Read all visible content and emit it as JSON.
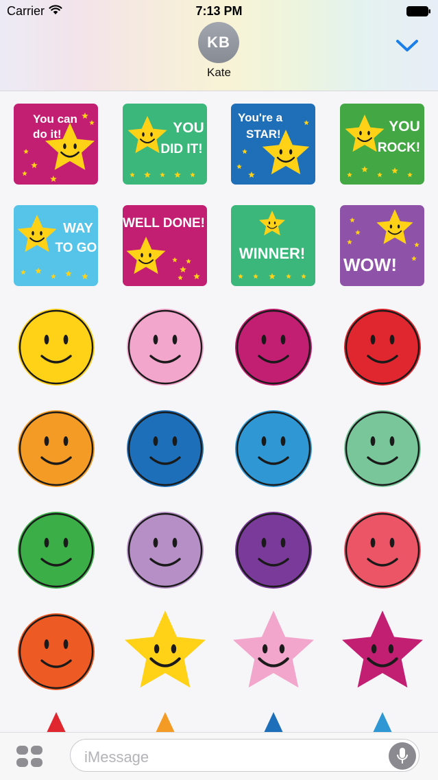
{
  "status_bar": {
    "carrier": "Carrier",
    "time": "7:13 PM"
  },
  "header": {
    "avatar_initials": "KB",
    "contact_name": "Kate"
  },
  "stickers": [
    {
      "type": "card",
      "name": "you-can-do-it",
      "bg": "#c31f72",
      "lines": [
        "You can",
        "do it!"
      ]
    },
    {
      "type": "card",
      "name": "you-did-it",
      "bg": "#3cb77c",
      "lines": [
        "YOU",
        "DID IT!"
      ]
    },
    {
      "type": "card",
      "name": "youre-a-star",
      "bg": "#1f6fb8",
      "lines": [
        "You're a",
        "STAR!"
      ]
    },
    {
      "type": "card",
      "name": "you-rock",
      "bg": "#43a844",
      "lines": [
        "YOU",
        "ROCK!"
      ]
    },
    {
      "type": "card",
      "name": "way-to-go",
      "bg": "#56c4e8",
      "lines": [
        "WAY",
        "TO GO!"
      ]
    },
    {
      "type": "card",
      "name": "well-done",
      "bg": "#c31f72",
      "lines": [
        "WELL DONE!"
      ]
    },
    {
      "type": "card",
      "name": "winner",
      "bg": "#3cb77c",
      "lines": [
        "WINNER!"
      ]
    },
    {
      "type": "card",
      "name": "wow",
      "bg": "#8e53a8",
      "lines": [
        "WOW!"
      ]
    },
    {
      "type": "smiley",
      "name": "yellow",
      "color": "#ffd218"
    },
    {
      "type": "smiley",
      "name": "pink",
      "color": "#f3a6cb"
    },
    {
      "type": "smiley",
      "name": "magenta",
      "color": "#c31f72"
    },
    {
      "type": "smiley",
      "name": "red",
      "color": "#e0262e"
    },
    {
      "type": "smiley",
      "name": "orange",
      "color": "#f49b25"
    },
    {
      "type": "smiley",
      "name": "blue",
      "color": "#1e6fb9"
    },
    {
      "type": "smiley",
      "name": "light-blue",
      "color": "#2f97d4"
    },
    {
      "type": "smiley",
      "name": "mint",
      "color": "#78c69a"
    },
    {
      "type": "smiley",
      "name": "green",
      "color": "#3cae48"
    },
    {
      "type": "smiley",
      "name": "lilac",
      "color": "#b58fc6"
    },
    {
      "type": "smiley",
      "name": "purple",
      "color": "#7a3a9a"
    },
    {
      "type": "smiley",
      "name": "coral",
      "color": "#ec5566"
    },
    {
      "type": "smiley",
      "name": "red-orange",
      "color": "#ee5a24"
    },
    {
      "type": "star",
      "name": "yellow",
      "color": "#ffd218"
    },
    {
      "type": "star",
      "name": "pink",
      "color": "#f3a6cb"
    },
    {
      "type": "star",
      "name": "magenta",
      "color": "#c31f72"
    },
    {
      "type": "partial",
      "name": "red",
      "color": "#e0262e"
    },
    {
      "type": "partial",
      "name": "orange",
      "color": "#f49b25"
    },
    {
      "type": "partial",
      "name": "blue",
      "color": "#1e6fb9"
    },
    {
      "type": "partial",
      "name": "light-blue",
      "color": "#2f97d4"
    }
  ],
  "compose": {
    "placeholder": "iMessage"
  },
  "icons": {
    "collapse": "chevron-down-icon",
    "apps": "app-drawer-icon",
    "mic": "microphone-icon",
    "wifi": "wifi-icon",
    "battery": "battery-icon"
  },
  "colors": {
    "accent": "#1a7fe8",
    "star_gold": "#ffd218"
  }
}
